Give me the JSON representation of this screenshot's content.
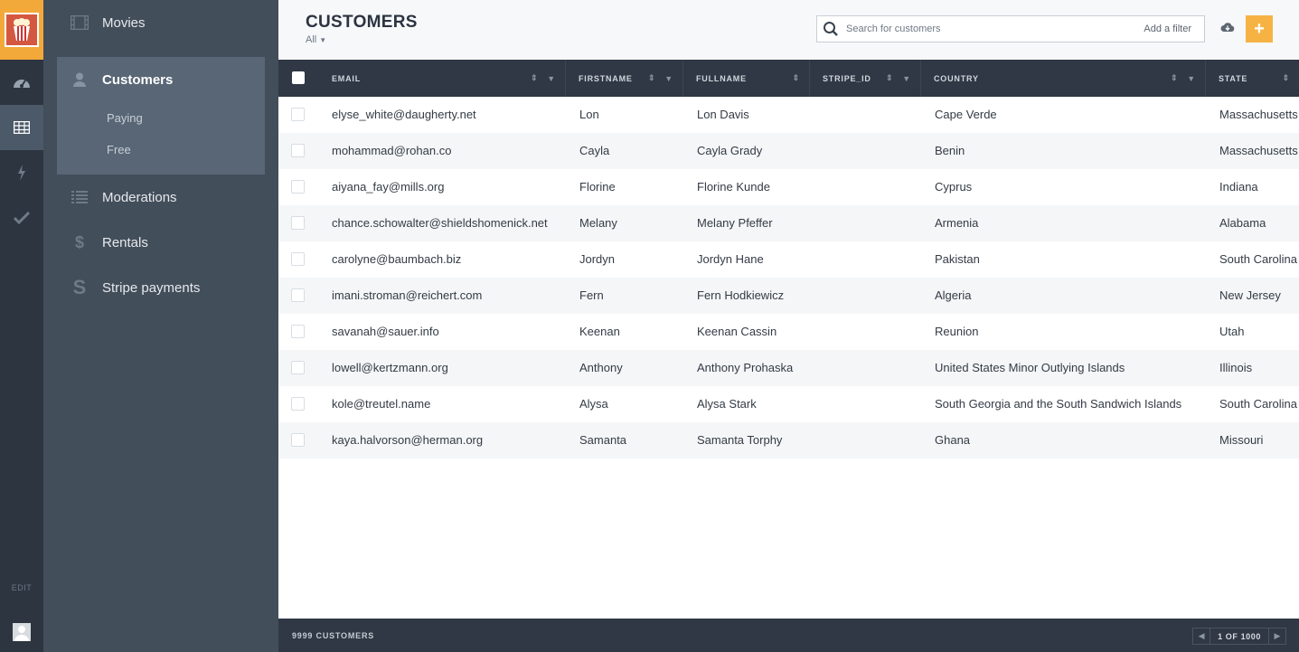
{
  "rail": {
    "edit_label": "EDIT"
  },
  "nav": {
    "items": [
      {
        "label": "Movies",
        "icon": "film-icon"
      },
      {
        "label": "Customers",
        "icon": "user-icon"
      },
      {
        "label": "Moderations",
        "icon": "list-icon"
      },
      {
        "label": "Rentals",
        "icon": "dollar-icon"
      },
      {
        "label": "Stripe payments",
        "icon": "stripe-s-icon"
      }
    ],
    "customers_sub": [
      "Paying",
      "Free"
    ]
  },
  "header": {
    "title": "CUSTOMERS",
    "scope": "All",
    "search_placeholder": "Search for customers",
    "add_filter_label": "Add a filter",
    "add_button": "+"
  },
  "table": {
    "columns": [
      "EMAIL",
      "FIRSTNAME",
      "FULLNAME",
      "STRIPE_ID",
      "COUNTRY",
      "STATE"
    ],
    "rows": [
      {
        "email": "elyse_white@daugherty.net",
        "firstname": "Lon",
        "fullname": "Lon Davis",
        "stripe_id": "",
        "country": "Cape Verde",
        "state": "Massachusetts"
      },
      {
        "email": "mohammad@rohan.co",
        "firstname": "Cayla",
        "fullname": "Cayla Grady",
        "stripe_id": "",
        "country": "Benin",
        "state": "Massachusetts"
      },
      {
        "email": "aiyana_fay@mills.org",
        "firstname": "Florine",
        "fullname": "Florine Kunde",
        "stripe_id": "",
        "country": "Cyprus",
        "state": "Indiana"
      },
      {
        "email": "chance.schowalter@shieldshomenick.net",
        "firstname": "Melany",
        "fullname": "Melany Pfeffer",
        "stripe_id": "",
        "country": "Armenia",
        "state": "Alabama"
      },
      {
        "email": "carolyne@baumbach.biz",
        "firstname": "Jordyn",
        "fullname": "Jordyn Hane",
        "stripe_id": "",
        "country": "Pakistan",
        "state": "South Carolina"
      },
      {
        "email": "imani.stroman@reichert.com",
        "firstname": "Fern",
        "fullname": "Fern Hodkiewicz",
        "stripe_id": "",
        "country": "Algeria",
        "state": "New Jersey"
      },
      {
        "email": "savanah@sauer.info",
        "firstname": "Keenan",
        "fullname": "Keenan Cassin",
        "stripe_id": "",
        "country": "Reunion",
        "state": "Utah"
      },
      {
        "email": "lowell@kertzmann.org",
        "firstname": "Anthony",
        "fullname": "Anthony Prohaska",
        "stripe_id": "",
        "country": "United States Minor Outlying Islands",
        "state": "Illinois"
      },
      {
        "email": "kole@treutel.name",
        "firstname": "Alysa",
        "fullname": "Alysa Stark",
        "stripe_id": "",
        "country": "South Georgia and the South Sandwich Islands",
        "state": "South Carolina"
      },
      {
        "email": "kaya.halvorson@herman.org",
        "firstname": "Samanta",
        "fullname": "Samanta Torphy",
        "stripe_id": "",
        "country": "Ghana",
        "state": "Missouri"
      }
    ]
  },
  "footer": {
    "count_label": "9999 CUSTOMERS",
    "page_label": "1 OF 1000"
  },
  "colors": {
    "accent": "#f6b343",
    "rail_bg": "#2d3540",
    "nav_bg": "#434e5b",
    "header_bg": "#2f3844"
  }
}
